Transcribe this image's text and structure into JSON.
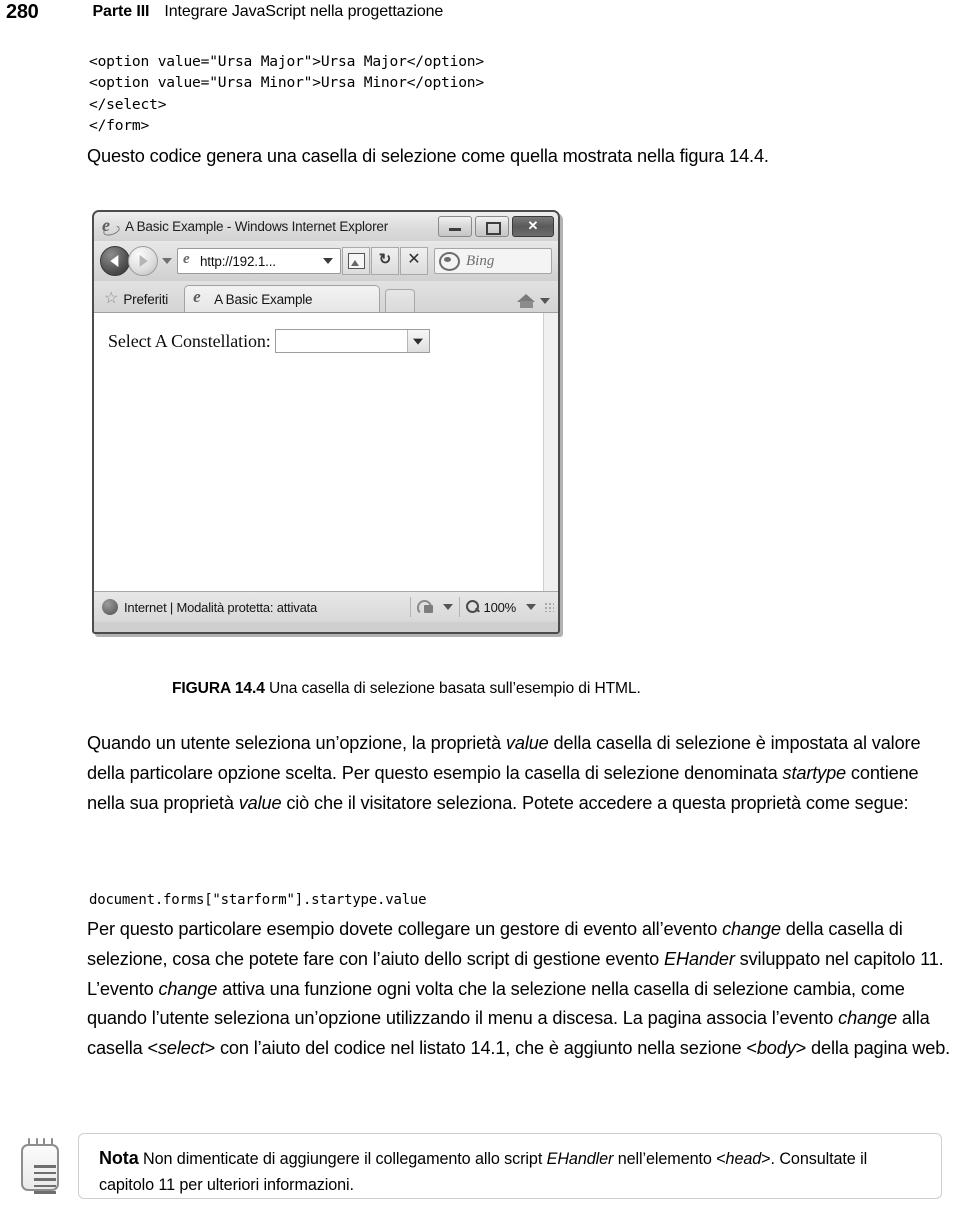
{
  "header": {
    "page_number": "280",
    "part": "Parte III",
    "title": "Integrare JavaScript nella progettazione"
  },
  "code_top": "<option value=\"Ursa Major\">Ursa Major</option>\n<option value=\"Ursa Minor\">Ursa Minor</option>\n</select>\n</form>",
  "paragraph_intro": "Questo codice genera una casella di selezione come quella mostrata nella figura 14.4.",
  "browser": {
    "title_bar": {
      "title": "A Basic Example - Windows Internet Explorer",
      "minimize": "",
      "maximize": "",
      "close": "✕"
    },
    "address_bar": {
      "url": "http://192.1...",
      "search_placeholder": "Bing"
    },
    "favorites_label": "Preferiti",
    "tab_label": "A Basic Example",
    "page": {
      "select_label": "Select A Constellation:",
      "select_value": ""
    },
    "status_bar": {
      "zone": "Internet | Modalità protetta: attivata",
      "zoom": "100%"
    }
  },
  "figure": {
    "label": "FIGURA 14.4",
    "caption": "Una casella di selezione basata sull’esempio di HTML."
  },
  "paragraph_one": {
    "t1": "Quando un utente seleziona un’opzione, la proprietà ",
    "i1": "value",
    "t2": " della casella di selezione è impostata al valore della particolare opzione scelta. Per questo esempio la casella di selezione denominata ",
    "i2": "startype",
    "t3": " contiene nella sua proprietà ",
    "i3": "value",
    "t4": " ciò che il visitatore seleziona. Potete accedere a questa proprietà come segue:"
  },
  "code_inline": "document.forms[\"starform\"].startype.value",
  "paragraph_two": {
    "t1": "Per questo particolare esempio dovete collegare un gestore di evento all’evento ",
    "i1": "change",
    "t2": " della casella di selezione, cosa che potete fare con l’aiuto dello script di gestione evento ",
    "i2": "EHander",
    "t3": " sviluppato nel capitolo 11. L’evento ",
    "i3": "change",
    "t4": " attiva una funzione ogni volta che la selezione nella casella di selezione cambia, come quando l’utente seleziona un’opzione utilizzando il menu a discesa. La pagina associa l’evento ",
    "i4": "change",
    "t5": " alla casella <",
    "i5": "select",
    "t6": "> con l’aiuto del codice nel listato 14.1, che è aggiunto nella sezione <",
    "i6": "body",
    "t7": "> della pagina web."
  },
  "note": {
    "title": "Nota",
    "t1": " Non dimenticate di aggiungere il collegamento allo script ",
    "i1": "EHandler",
    "t2": " nell’elemento <",
    "i2": "head",
    "t3": ">. Consultate il capitolo 11 per ulteriori informazioni."
  }
}
